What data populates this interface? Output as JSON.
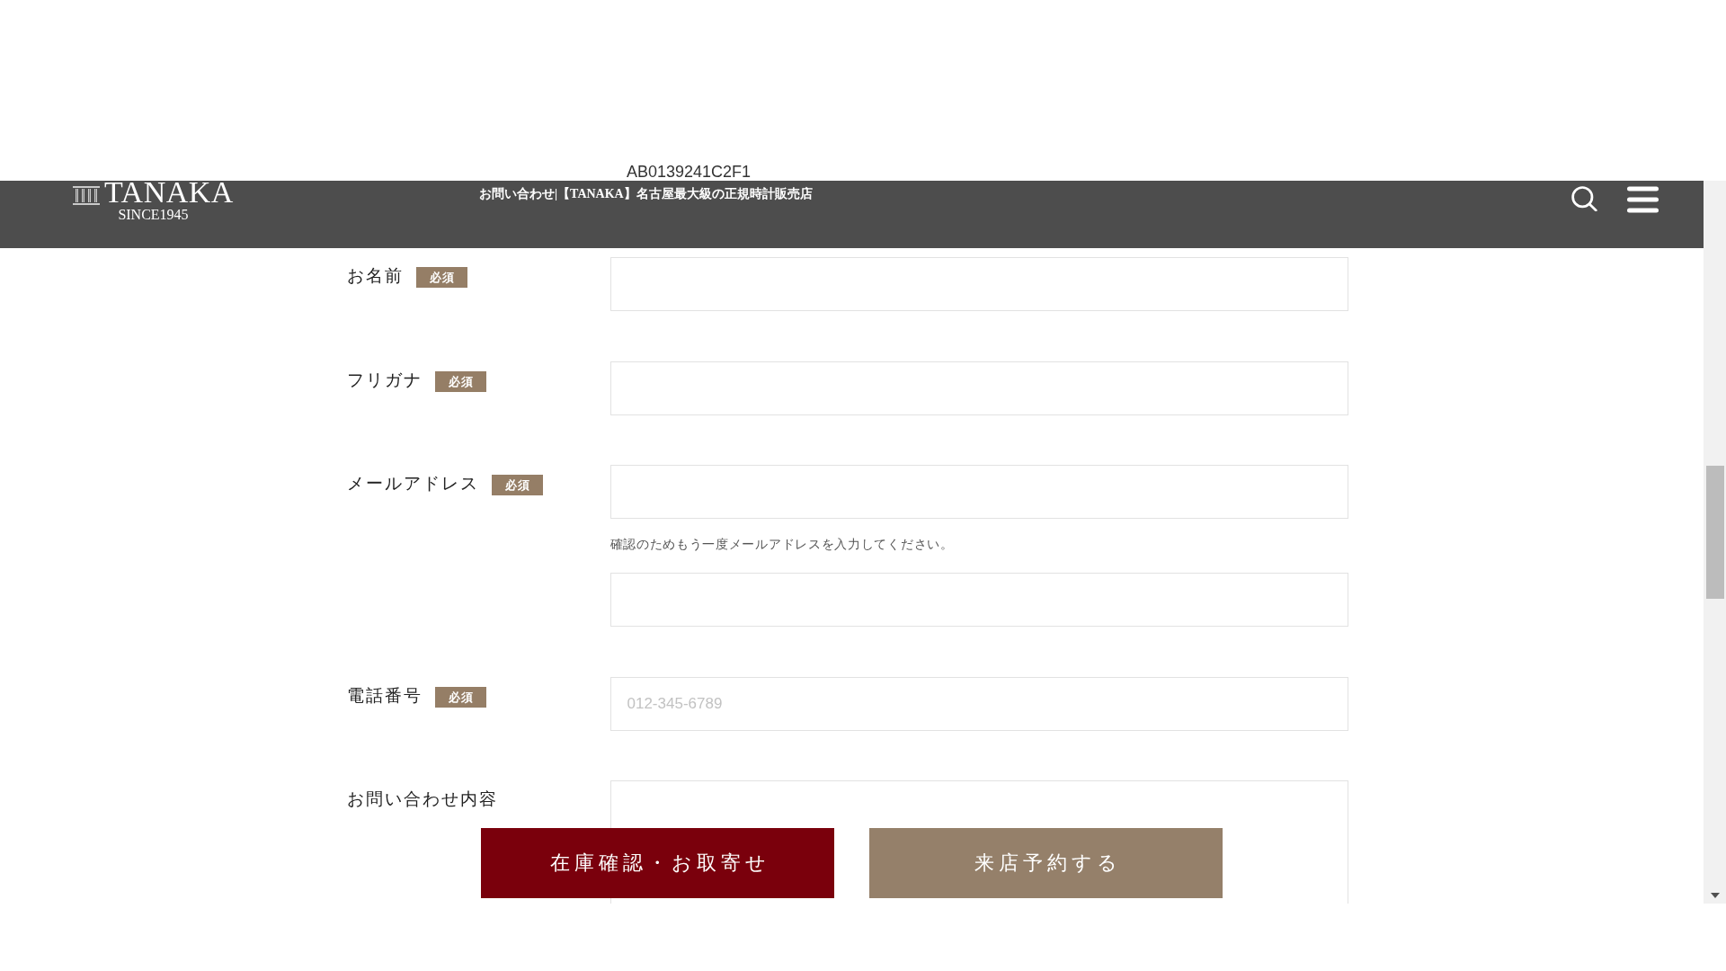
{
  "top_field": {
    "value": "AB0139241C2F1"
  },
  "header": {
    "logo": {
      "wordmark": "TANAKA",
      "tagline": "SINCE1945"
    },
    "title": "お問い合わせ|【TANAKA】名古屋最大級の正規時計販売店"
  },
  "form": {
    "fields": [
      {
        "label": "お名前",
        "badge": "必須",
        "kind": "text"
      },
      {
        "label": "フリガナ",
        "badge": "必須",
        "kind": "text"
      },
      {
        "label": "メールアドレス",
        "badge": "必須",
        "kind": "text",
        "confirm": {
          "hint": "確認のためもう一度メールアドレスを入力してください。"
        }
      },
      {
        "label": "電話番号",
        "badge": "必須",
        "kind": "text",
        "placeholder": "012-345-6789"
      },
      {
        "label": "お問い合わせ内容",
        "kind": "textarea"
      }
    ]
  },
  "actions": [
    {
      "label": "在庫確認・お取寄せ",
      "kind": "primary"
    },
    {
      "label": "来店予約する",
      "kind": "secondary"
    }
  ]
}
